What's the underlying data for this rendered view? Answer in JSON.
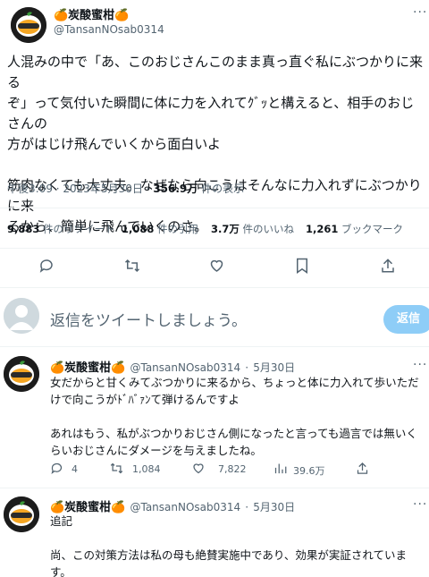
{
  "main_tweet": {
    "author_name": "🍊炭酸蜜柑🍊",
    "author_handle": "@TansanNOsab0314",
    "more": "···",
    "lines": [
      "人混みの中で「あ、このおじさんこのまま真っ直ぐ私にぶつかりに来る",
      "ぞ」って気付いた瞬間に体に力を入れてｸﾞｯと構えると、相手のおじさんの",
      "方がはじけ飛んでいくから面白いよ",
      "",
      "筋肉なくても大丈夫。なぜなら向こうはそんなに力入れずにぶつかりに来",
      "るから、簡単に飛んでいくのさ。"
    ],
    "time": "午後3:09",
    "date": "2023年5月30日",
    "views_value": "356.9万",
    "views_label": "件の表示",
    "retweets_value": "9,883",
    "retweets_label": "件のリツイート",
    "quotes_value": "1,088",
    "quotes_label": "件の引用",
    "likes_value": "3.7万",
    "likes_label": "件のいいね",
    "bookmarks_value": "1,261",
    "bookmarks_label": "ブックマーク",
    "actions": [
      "reply-icon",
      "retweet-icon",
      "like-icon",
      "bookmark-icon",
      "share-icon"
    ]
  },
  "composer": {
    "placeholder": "返信をツイートしましょう。",
    "button_label": "返信"
  },
  "replies": [
    {
      "author_name": "🍊炭酸蜜柑🍊",
      "author_handle": "@TansanNOsab0314",
      "date": "5月30日",
      "more": "···",
      "lines": [
        "女だからと甘くみてぶつかりに来るから、ちょっと体に力入れて歩いただ",
        "けで向こうがﾄﾞﾊﾞｧﾝて弾けるんですよ",
        "",
        "あれはもう、私がぶつかりおじさん側になったと言っても過言では無いく",
        "らいおじさんにダメージを与えましたね。"
      ],
      "replies_count": "4",
      "retweets_count": "1,084",
      "likes_count": "7,822",
      "views_count": "39.6万"
    },
    {
      "author_name": "🍊炭酸蜜柑🍊",
      "author_handle": "@TansanNOsab0314",
      "date": "5月30日",
      "more": "···",
      "lines": [
        "追記",
        "",
        "尚、この対策方法は私の母も絶賛実施中であり、効果が実証されていま",
        "す。"
      ]
    }
  ],
  "colors": {
    "text": "#0f1419",
    "secondary": "#536471",
    "divider": "#eff3f4",
    "reply_button": "#8ecdf7",
    "avatar_bg": "#1c1c1c",
    "orange": "#f5a623"
  }
}
